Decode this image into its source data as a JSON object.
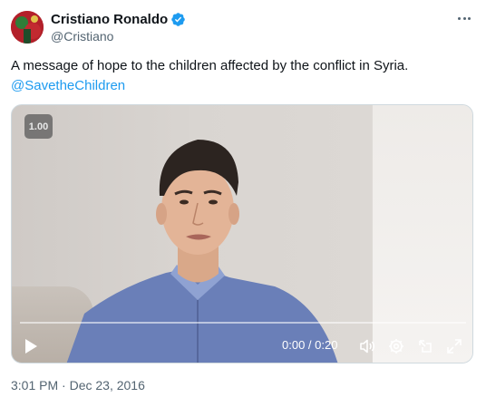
{
  "author": {
    "display_name": "Cristiano Ronaldo",
    "handle": "@Cristiano",
    "verified_icon": "verified-badge-icon",
    "verified_color": "#1d9bf0"
  },
  "tweet": {
    "text": "A message of hope to the children affected by the conflict in Syria.",
    "mention": "@SavetheChildren",
    "timestamp": "3:01 PM · Dec 23, 2016"
  },
  "video": {
    "speed_label": "1.00",
    "time_display": "0:00 / 0:20",
    "progress_fraction": 0,
    "controls": [
      "play-icon",
      "volume-icon",
      "settings-icon",
      "pip-icon",
      "fullscreen-icon"
    ]
  },
  "colors": {
    "link": "#1d9bf0",
    "secondary_text": "#536471",
    "primary_text": "#0f1419"
  }
}
